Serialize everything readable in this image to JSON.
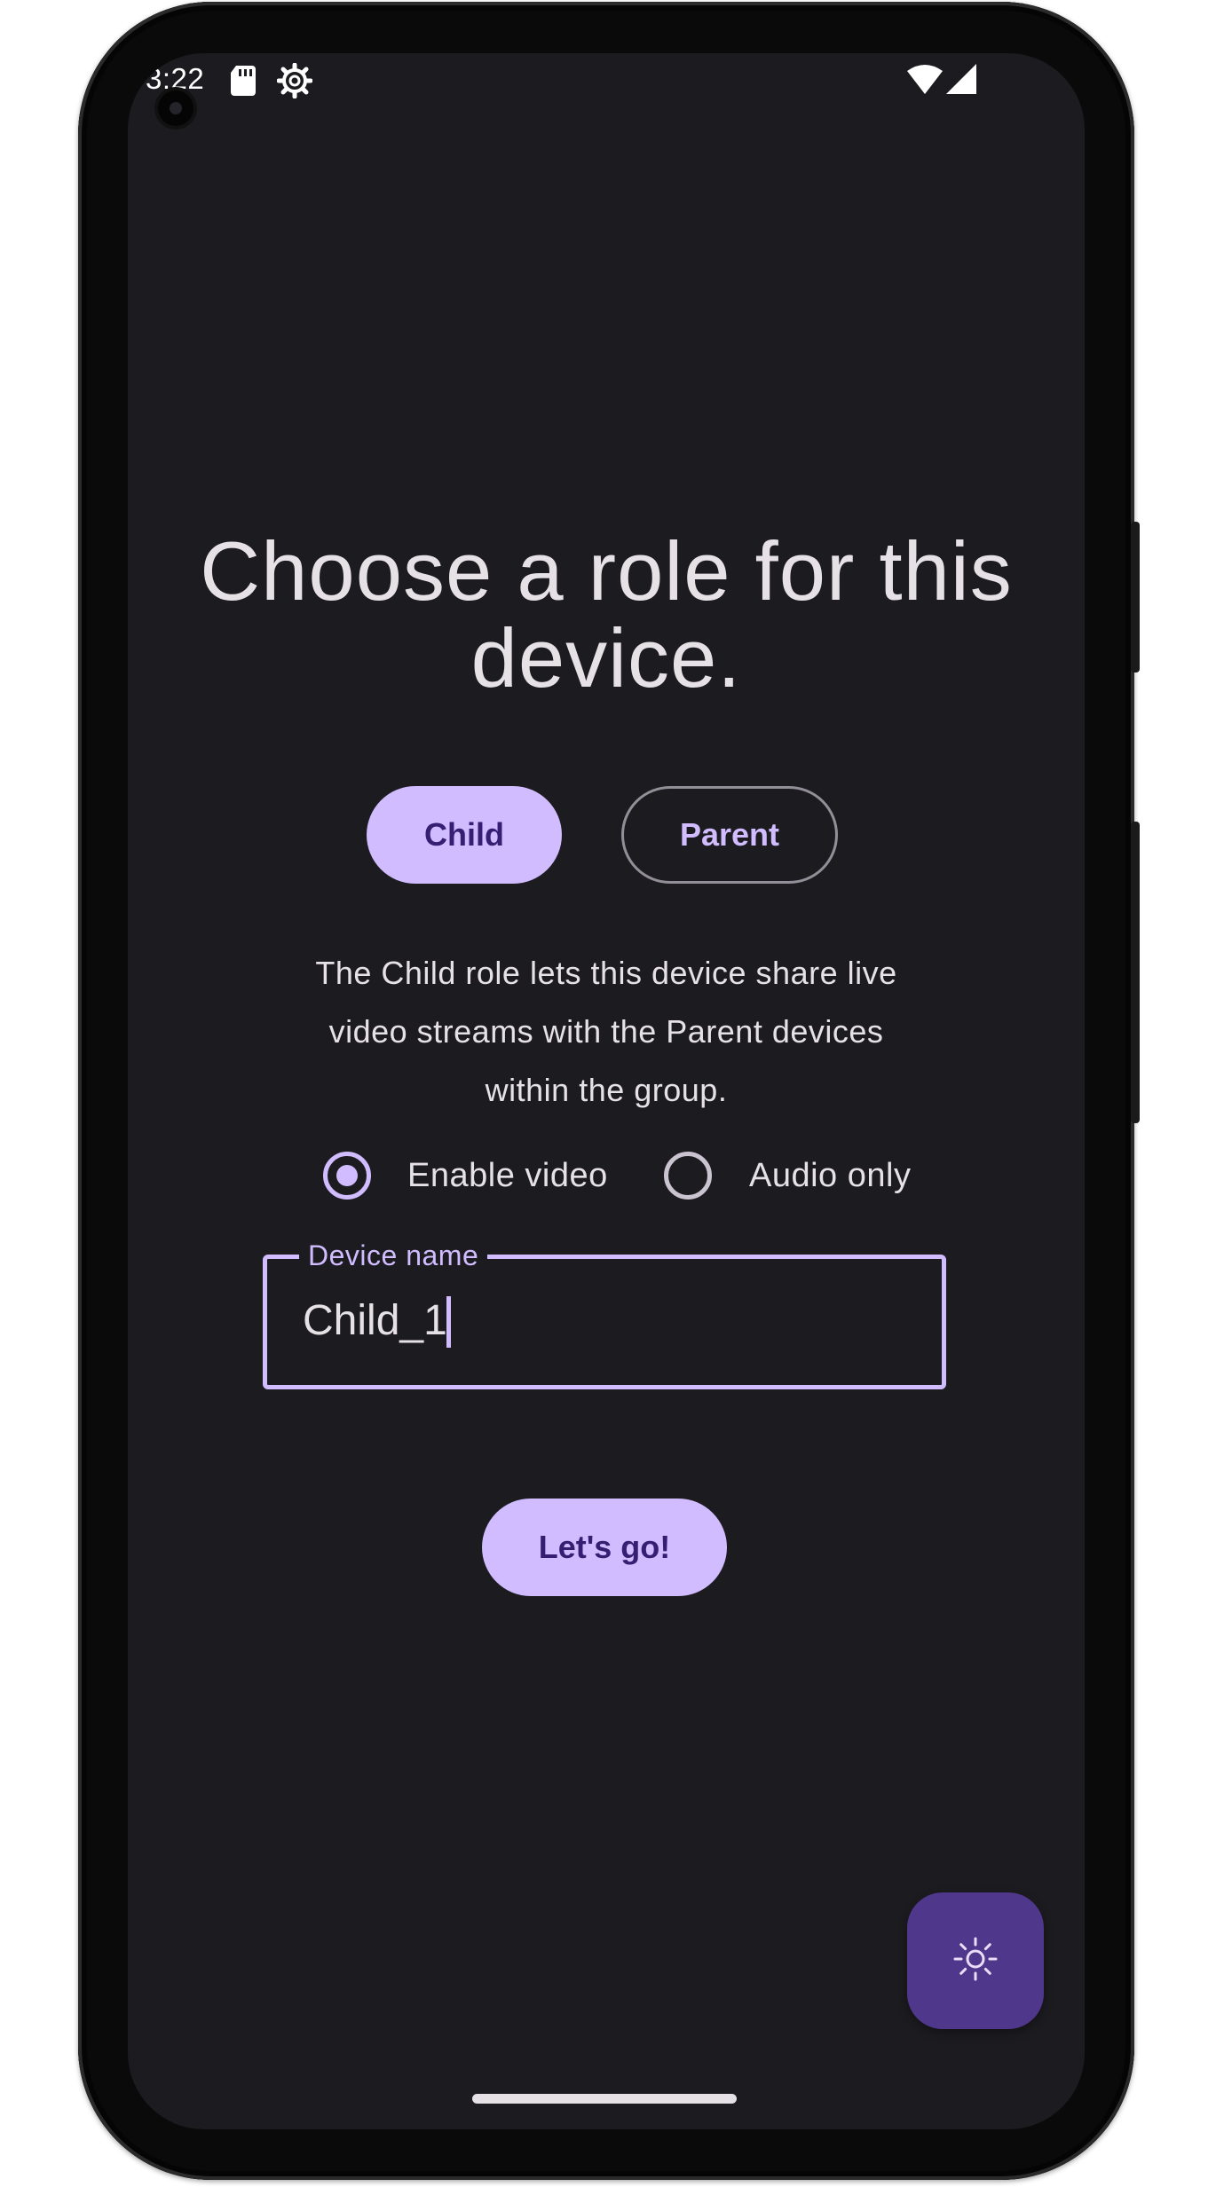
{
  "status_bar": {
    "time": "3:22",
    "icons": [
      "sd-card-icon",
      "settings-gear-icon",
      "wifi-icon",
      "signal-icon"
    ]
  },
  "screen": {
    "title": "Choose a role for this device.",
    "roles": {
      "child_label": "Child",
      "parent_label": "Parent",
      "selected": "Child"
    },
    "description": "The Child role lets this device share live video streams with the Parent devices within the group.",
    "media_options": {
      "enable_video_label": "Enable video",
      "audio_only_label": "Audio only",
      "selected": "Enable video"
    },
    "device_name": {
      "label": "Device name",
      "value": "Child_1"
    },
    "submit_label": "Let's go!",
    "fab_icon": "brightness-sun-icon"
  },
  "colors": {
    "background": "#1c1b1f",
    "primary": "#d0bcff",
    "on_primary": "#381e72",
    "fab": "#4f378b",
    "on_surface": "#e6e1e5",
    "outline": "#938f99"
  }
}
